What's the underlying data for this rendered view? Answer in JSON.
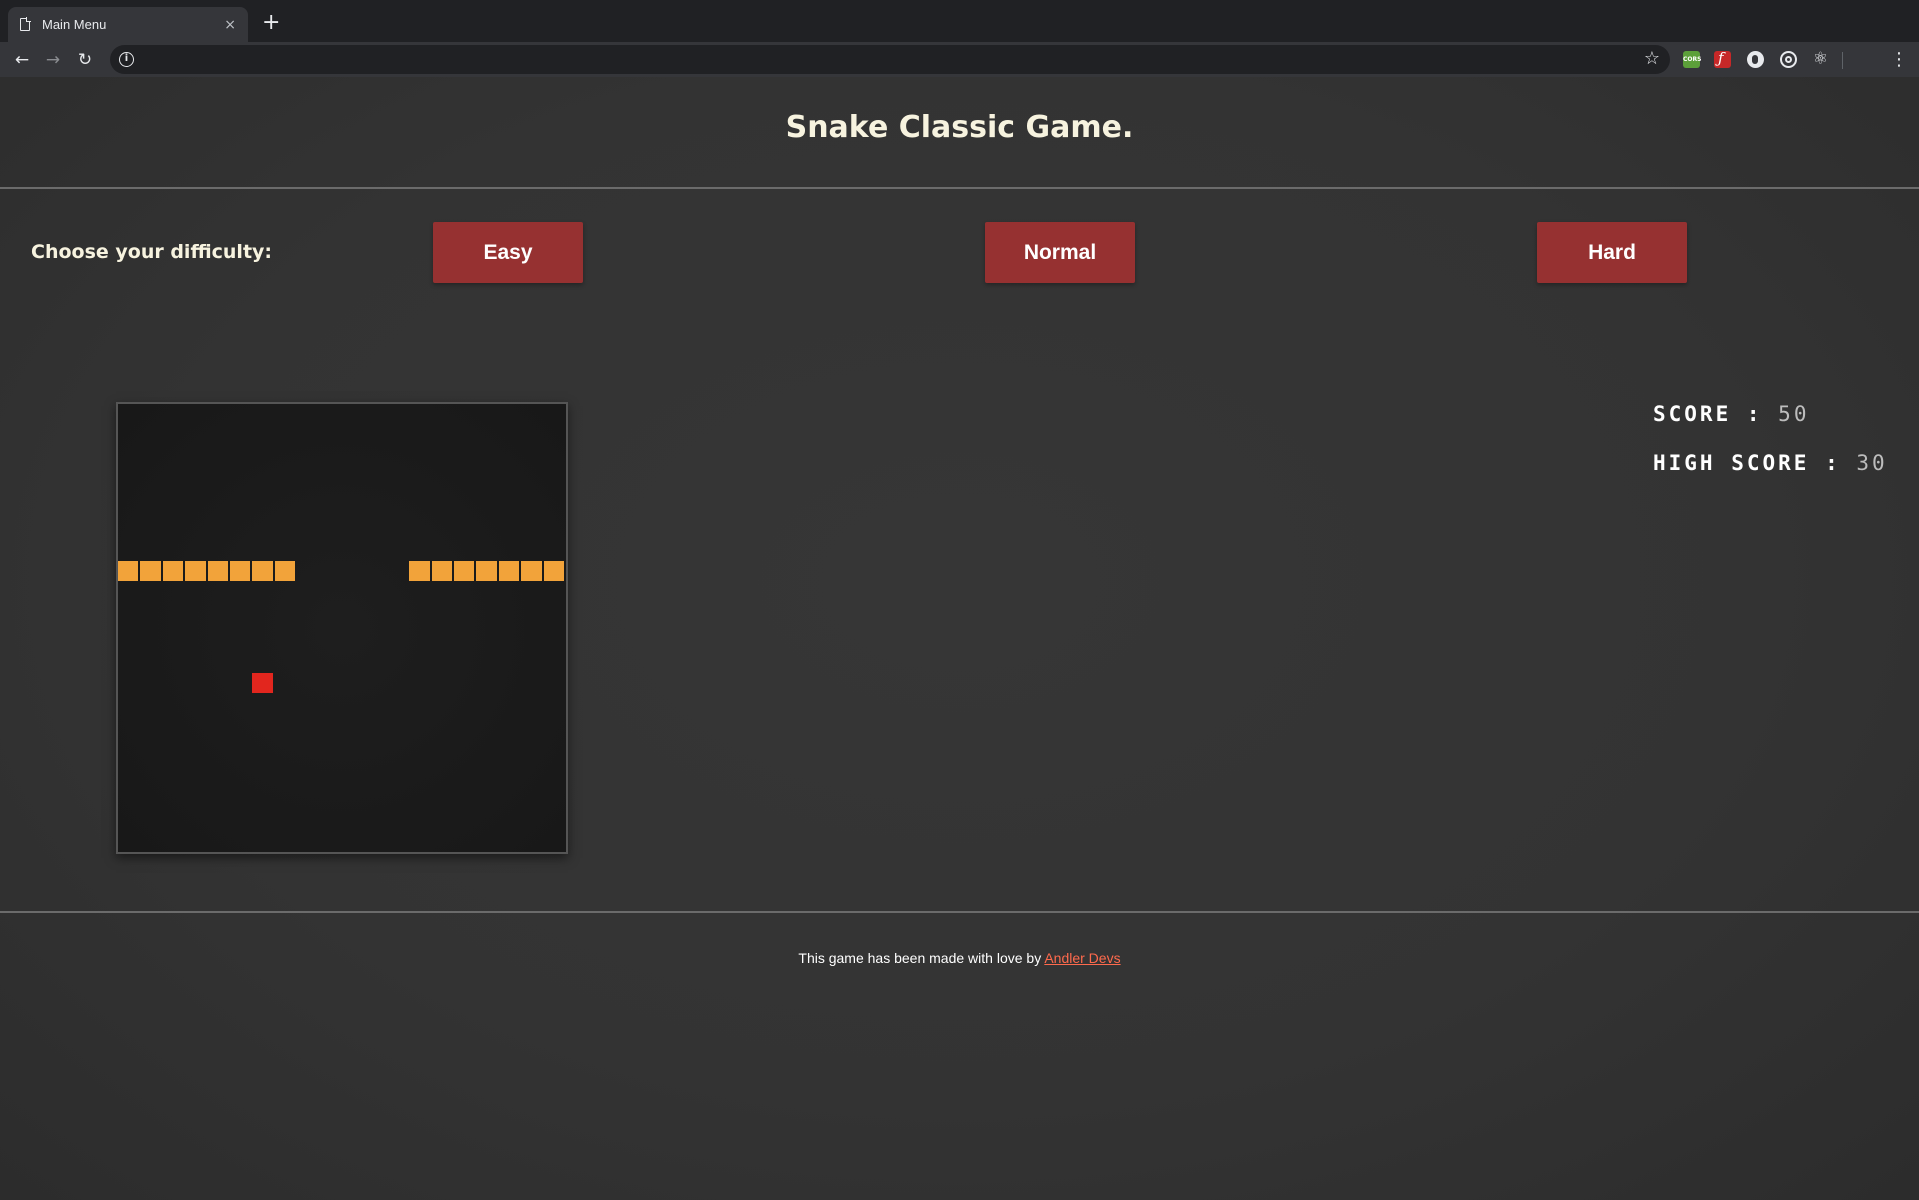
{
  "browser": {
    "tab_title": "Main Menu",
    "tab_close": "×",
    "new_tab": "+",
    "back": "←",
    "forward": "→",
    "reload": "↻",
    "info": "i",
    "bookmark": "☆",
    "ext_cors": "CORS",
    "ext_react": "⚛",
    "menu": "⋮"
  },
  "page": {
    "title": "Snake Classic Game.",
    "difficulty_label": "Choose your difficulty:",
    "buttons": {
      "easy": "Easy",
      "normal": "Normal",
      "hard": "Hard"
    }
  },
  "score": {
    "score_label": "SCORE :",
    "score_value": "50",
    "high_score_label": "HIGH SCORE :",
    "high_score_value": "30"
  },
  "game": {
    "grid_cells": 20,
    "snake_cells": [
      [
        0,
        7
      ],
      [
        1,
        7
      ],
      [
        2,
        7
      ],
      [
        3,
        7
      ],
      [
        4,
        7
      ],
      [
        5,
        7
      ],
      [
        6,
        7
      ],
      [
        7,
        7
      ],
      [
        13,
        7
      ],
      [
        14,
        7
      ],
      [
        15,
        7
      ],
      [
        16,
        7
      ],
      [
        17,
        7
      ],
      [
        18,
        7
      ],
      [
        19,
        7
      ]
    ],
    "food_cell": [
      6,
      12
    ],
    "colors": {
      "snake": "#f2a33a",
      "food": "#e2261e",
      "board": "#1b1b1b",
      "button": "#963131",
      "link": "#ff6a4d"
    }
  },
  "footer": {
    "text": "This game has been made with love by",
    "link_text": "Andler Devs"
  }
}
